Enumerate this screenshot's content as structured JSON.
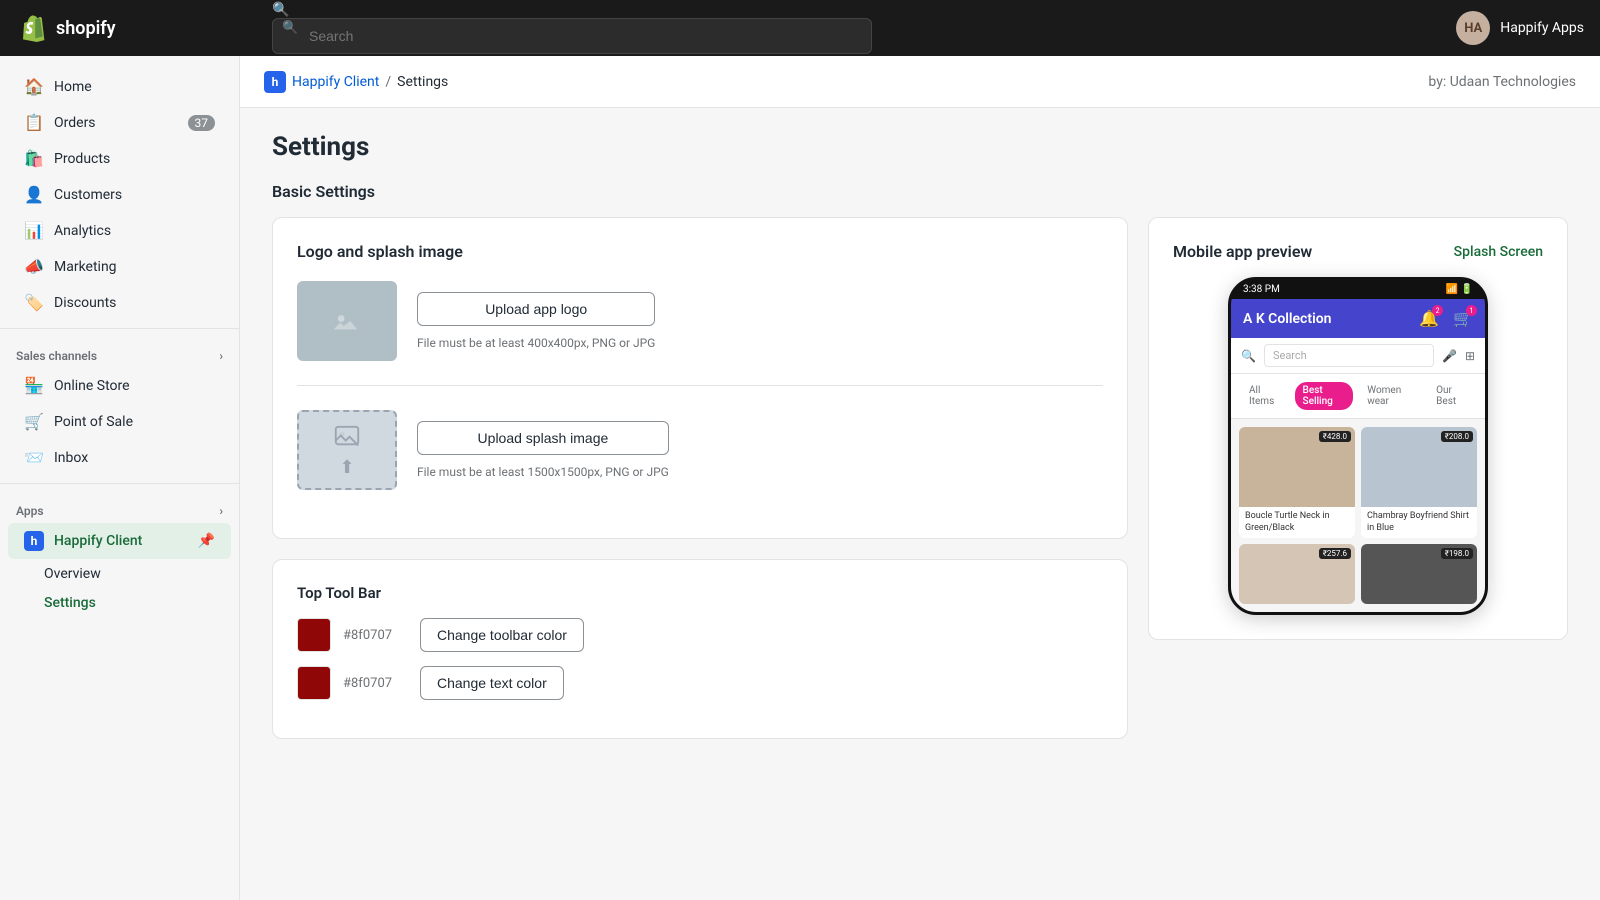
{
  "topbar": {
    "logo_text": "shopify",
    "search_placeholder": "Search",
    "user_initials": "HA",
    "user_name": "Happify Apps"
  },
  "sidebar": {
    "nav_items": [
      {
        "id": "home",
        "label": "Home",
        "icon": "🏠"
      },
      {
        "id": "orders",
        "label": "Orders",
        "icon": "📋",
        "badge": "37"
      },
      {
        "id": "products",
        "label": "Products",
        "icon": "🛍️"
      },
      {
        "id": "customers",
        "label": "Customers",
        "icon": "👤"
      },
      {
        "id": "analytics",
        "label": "Analytics",
        "icon": "📊"
      },
      {
        "id": "marketing",
        "label": "Marketing",
        "icon": "📣"
      },
      {
        "id": "discounts",
        "label": "Discounts",
        "icon": "🏷️"
      }
    ],
    "sales_channels_title": "Sales channels",
    "sales_channels": [
      {
        "id": "online-store",
        "label": "Online Store",
        "icon": "🏪"
      },
      {
        "id": "point-of-sale",
        "label": "Point of Sale",
        "icon": "🛒"
      },
      {
        "id": "inbox",
        "label": "Inbox",
        "icon": "📨"
      }
    ],
    "apps_title": "Apps",
    "apps": [
      {
        "id": "happify-client",
        "label": "Happify Client",
        "icon": "h",
        "active": true
      }
    ],
    "sub_items": [
      {
        "id": "overview",
        "label": "Overview"
      },
      {
        "id": "settings",
        "label": "Settings",
        "active": true
      }
    ]
  },
  "breadcrumb": {
    "app_icon": "h",
    "parent_label": "Happify Client",
    "separator": "/",
    "current_label": "Settings",
    "by_text": "by: Udaan Technologies"
  },
  "page": {
    "title": "Settings",
    "basic_settings_title": "Basic Settings"
  },
  "logo_splash_card": {
    "title": "Logo and splash image",
    "upload_logo_btn": "Upload app logo",
    "logo_hint": "File must be at least 400x400px, PNG or JPG",
    "upload_splash_btn": "Upload splash image",
    "splash_hint": "File must be at least 1500x1500px, PNG or JPG"
  },
  "toolbar_card": {
    "title": "Top Tool Bar",
    "toolbar_color_hex": "#8f0707",
    "toolbar_color_btn": "Change toolbar color",
    "text_color_hex": "#8f0707",
    "text_color_btn": "Change text color"
  },
  "preview_card": {
    "title": "Mobile app preview",
    "splash_link": "Splash Screen",
    "phone": {
      "status_time": "3:38 PM",
      "app_bar_title": "A K Collection",
      "search_placeholder": "Search",
      "tabs": [
        "All Items",
        "Best Selling",
        "Women wear",
        "Our Best"
      ],
      "active_tab": "Best Selling",
      "products": [
        {
          "name": "Boucle Turtle Neck in Green/Black",
          "price": "₹428.0",
          "bg": "warm"
        },
        {
          "name": "Chambray Boyfriend Shirt in Blue",
          "price": "₹208.0",
          "bg": "blue"
        },
        {
          "name": "",
          "price": "₹257.6",
          "bg": "warm2"
        },
        {
          "name": "",
          "price": "₹198.0",
          "bg": "dark"
        }
      ]
    }
  }
}
